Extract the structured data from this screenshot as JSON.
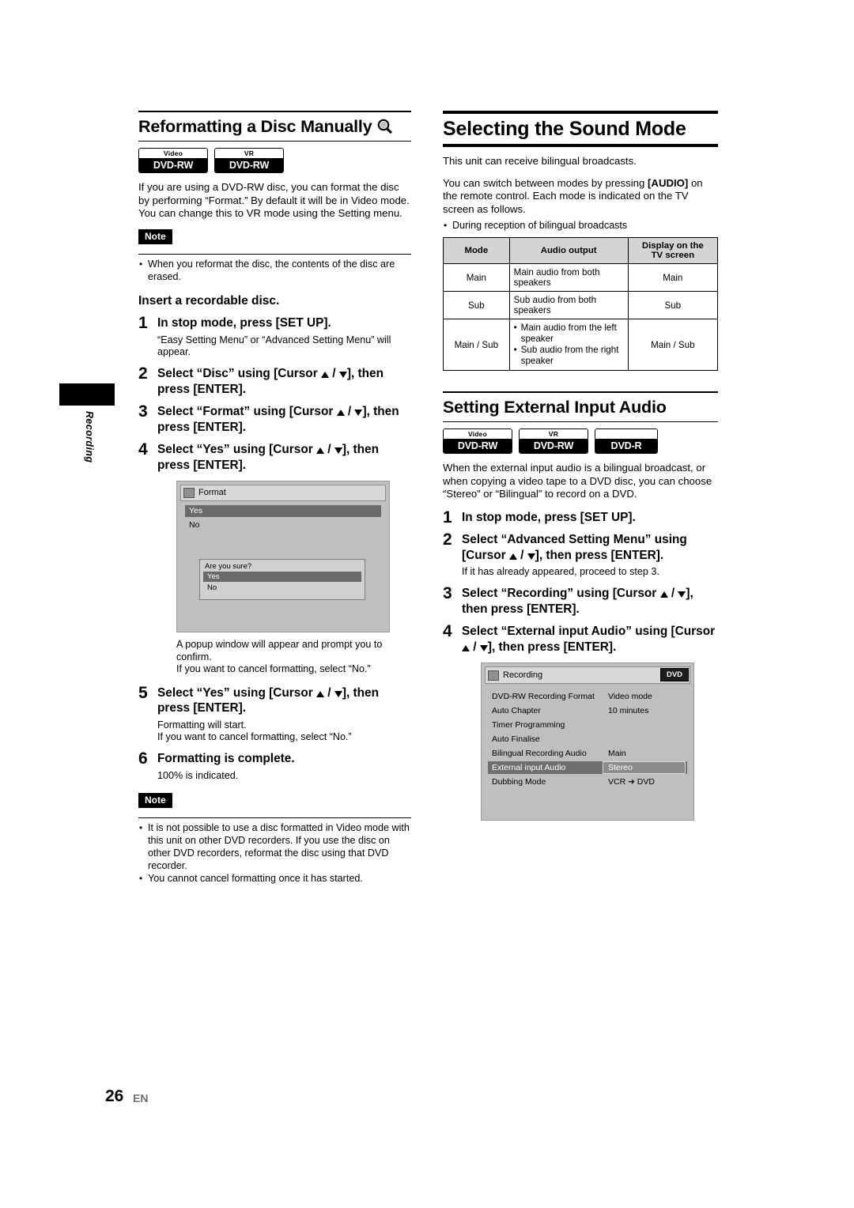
{
  "page": {
    "number": "26",
    "lang": "EN",
    "side_tab_label": "Recording"
  },
  "left": {
    "heading": "Reformatting a Disc Manually",
    "logos": [
      {
        "top": "Video",
        "bottom": "DVD-RW"
      },
      {
        "top": "VR",
        "bottom": "DVD-RW"
      }
    ],
    "intro": "If you are using a DVD-RW disc, you can format the disc by performing “Format.” By default it will be in Video mode. You can change this to VR mode using the Setting menu.",
    "note_label": "Note",
    "note_items": [
      "When you reformat the disc, the contents of the disc are erased."
    ],
    "insert_line": "Insert a recordable disc.",
    "steps": [
      {
        "num": "1",
        "text": "In stop mode, press [SET UP].",
        "sub": "“Easy Setting Menu” or “Advanced Setting Menu” will appear."
      },
      {
        "num": "2",
        "text_pre": "Select “Disc” using [Cursor ",
        "text_post": "], then press [ENTER].",
        "sub": ""
      },
      {
        "num": "3",
        "text_pre": "Select “Format” using [Cursor ",
        "text_post": "], then press [ENTER].",
        "sub": ""
      },
      {
        "num": "4",
        "text_pre": "Select “Yes” using [Cursor ",
        "text_post": "], then press [ENTER].",
        "sub": ""
      },
      {
        "num": "5",
        "text_pre": "Select “Yes” using [Cursor ",
        "text_post": "], then press [ENTER].",
        "sub": "Formatting will start.\nIf you want to cancel formatting, select “No.”"
      },
      {
        "num": "6",
        "text": "Formatting is complete.",
        "sub": "100% is indicated."
      }
    ],
    "format_screen": {
      "title": "Format",
      "option_yes": "Yes",
      "option_no": "No",
      "popup_question": "Are you sure?",
      "popup_yes": "Yes",
      "popup_no": "No"
    },
    "after_screen_text": "A popup window will appear and prompt you to confirm.\nIf you want to cancel formatting, select “No.”",
    "after_screen_line1": "A popup window will appear and prompt you to confirm.",
    "after_screen_line2": "If you want to cancel formatting, select “No.”",
    "step5_sub1": "Formatting will start.",
    "step5_sub2": "If you want to cancel formatting, select “No.”",
    "step6_sub": "100% is indicated.",
    "note2_label": "Note",
    "note2_items": [
      "It is not possible to use a disc formatted in Video mode with this unit on other DVD recorders. If you use the disc on other DVD recorders, reformat the disc using that DVD recorder.",
      "You cannot cancel formatting once it has started."
    ]
  },
  "right": {
    "heading_sound": "Selecting the Sound Mode",
    "para1": "This unit can receive bilingual broadcasts.",
    "para2_pre": "You can switch between modes by pressing ",
    "para2_key": "[AUDIO]",
    "para2_post": " on the remote control. Each mode is indicated on the TV screen as follows.",
    "bullet_reception": "During reception of bilingual broadcasts",
    "table": {
      "headers": [
        "Mode",
        "Audio output",
        "Display on the TV screen"
      ],
      "header_display_line1": "Display on the",
      "header_display_line2": "TV screen",
      "rows": [
        {
          "mode": "Main",
          "output": "Main audio from both speakers",
          "display": "Main"
        },
        {
          "mode": "Sub",
          "output": "Sub audio from both speakers",
          "display": "Sub"
        },
        {
          "mode": "Main / Sub",
          "output_list": [
            "Main audio from the left speaker",
            "Sub audio from the right speaker"
          ],
          "display": "Main / Sub"
        }
      ]
    },
    "heading_ext": "Setting External Input Audio",
    "logos": [
      {
        "top": "Video",
        "bottom": "DVD-RW"
      },
      {
        "top": "VR",
        "bottom": "DVD-RW"
      },
      {
        "top": "",
        "bottom": "DVD-R"
      }
    ],
    "ext_intro": "When the external input audio is a bilingual broadcast, or when copying a video tape to a DVD disc, you can choose “Stereo” or “Bilingual” to record on a DVD.",
    "steps": [
      {
        "num": "1",
        "text": "In stop mode, press [SET UP]."
      },
      {
        "num": "2",
        "text_pre": "Select “Advanced Setting Menu” using [Cursor ",
        "text_post": "], then press [ENTER].",
        "sub": "If it has already appeared, proceed to step 3."
      },
      {
        "num": "3",
        "text_pre": "Select “Recording” using [Cursor ",
        "text_post": "], then press [ENTER]."
      },
      {
        "num": "4",
        "text_pre": "Select “External input Audio” using [Cursor ",
        "text_post": "], then press [ENTER]."
      }
    ],
    "rec_screen": {
      "title": "Recording",
      "badge": "DVD",
      "rows": [
        {
          "label": "DVD-RW Recording Format",
          "value": "Video mode",
          "selected": false
        },
        {
          "label": "Auto Chapter",
          "value": "10 minutes",
          "selected": false
        },
        {
          "label": "Timer Programming",
          "value": "",
          "selected": false
        },
        {
          "label": "Auto Finalise",
          "value": "",
          "selected": false
        },
        {
          "label": "Bilingual Recording Audio",
          "value": "Main",
          "selected": false
        },
        {
          "label": "External input Audio",
          "value": "Stereo",
          "selected": true
        },
        {
          "label": "Dubbing Mode",
          "value": "VCR ➜ DVD",
          "selected": false
        }
      ]
    }
  }
}
